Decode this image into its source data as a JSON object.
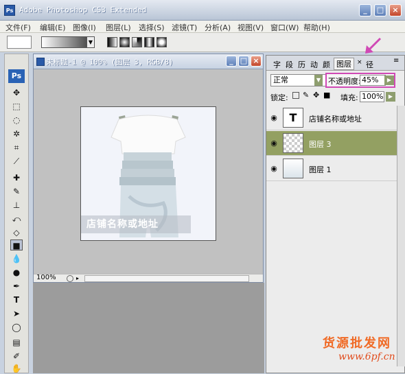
{
  "app": {
    "title": "Adobe Photoshop CS3 Extended"
  },
  "menu": [
    "文件(F)",
    "编辑(E)",
    "图像(I)",
    "图层(L)",
    "选择(S)",
    "滤镜(T)",
    "分析(A)",
    "视图(V)",
    "窗口(W)",
    "帮助(H)"
  ],
  "document": {
    "title": "未标题-1 @ 100% (图层 3, RGB/8)",
    "caption": "店铺名称或地址",
    "zoom": "100%"
  },
  "panel": {
    "tabs": [
      "字",
      "段",
      "历",
      "动",
      "颜",
      "图层",
      "径"
    ],
    "blend_mode": "正常",
    "opacity_label": "不透明度:",
    "opacity_value": "45%",
    "lock_label": "锁定:",
    "fill_label": "填充:",
    "fill_value": "100%",
    "layers": [
      {
        "name": "店铺名称或地址",
        "thumb": "T",
        "selected": false
      },
      {
        "name": "图层 3",
        "thumb": "",
        "selected": true
      },
      {
        "name": "图层 1",
        "thumb": "",
        "selected": false
      }
    ]
  },
  "watermark": {
    "line1": "货源批发网",
    "line2": "www.6pf.cn"
  },
  "colors": {
    "accent": "#d049b5",
    "selected_layer": "#93a062",
    "watermark": "#f06a25"
  }
}
